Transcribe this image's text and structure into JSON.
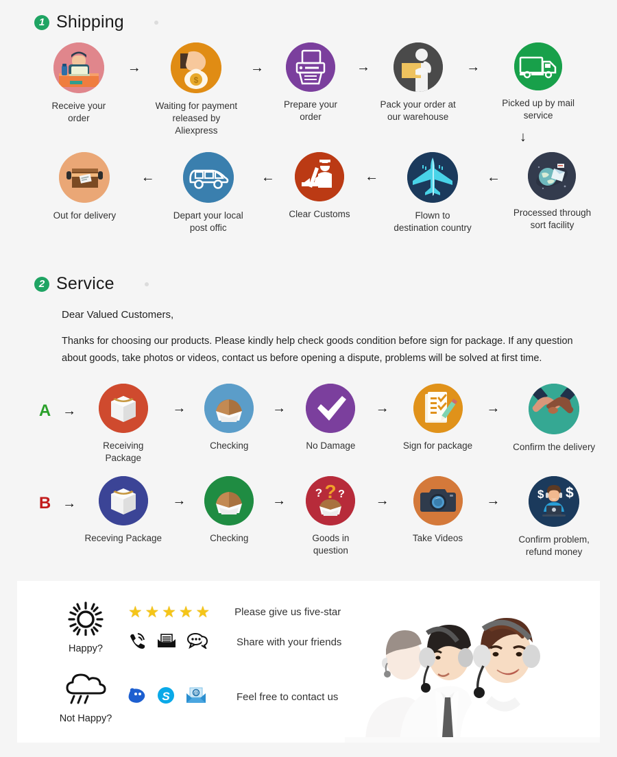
{
  "page": {
    "background": "#f5f5f5",
    "card_background": "#ffffff",
    "badge_color": "#1fa463",
    "text_color": "#333333"
  },
  "sections": [
    {
      "number": "1",
      "title": "Shipping"
    },
    {
      "number": "2",
      "title": "Service"
    }
  ],
  "shipping": {
    "row1": [
      {
        "label": "Receive your order",
        "icon": "person-at-desk-icon",
        "color": "#e0868c"
      },
      {
        "label": "Waiting for payment\nreleased by Aliexpress",
        "icon": "hand-money-bag-icon",
        "color": "#e08c14"
      },
      {
        "label": "Prepare your order",
        "icon": "printer-icon",
        "color": "#7b3f9d"
      },
      {
        "label": "Pack your order at\nour warehouse",
        "icon": "worker-package-icon",
        "color": "#4a4a4a"
      },
      {
        "label": "Picked up by mail service",
        "icon": "delivery-truck-icon",
        "color": "#18a04a"
      }
    ],
    "row2": [
      {
        "label": "Out for delivery",
        "icon": "parcel-box-icon",
        "color": "#eaa776"
      },
      {
        "label": "Depart your local\npost offic",
        "icon": "delivery-van-icon",
        "color": "#3a7fae"
      },
      {
        "label": "Clear  Customs",
        "icon": "customs-officer-icon",
        "color": "#bb3a14"
      },
      {
        "label": "Flown to\ndestination country",
        "icon": "airplane-icon",
        "color": "#1b3a5c"
      },
      {
        "label": "Processed through\nsort facility",
        "icon": "globe-mail-icon",
        "color": "#333b4d"
      }
    ],
    "arrow_right": "→",
    "arrow_left": "←",
    "arrow_down": "↓"
  },
  "service": {
    "greeting": "Dear Valued Customers,",
    "body": "Thanks for choosing our products. Please kindly help check goods condition before sign for package. If any question about goods, take photos or videos, contact us before opening a dispute, problems will be solved at first time.",
    "row_a": {
      "letter": "A",
      "letter_color": "#2aa02a",
      "steps": [
        {
          "label": "Receiving Package",
          "icon": "white-box-icon",
          "color": "#cf4a2e"
        },
        {
          "label": "Checking",
          "icon": "open-carton-icon",
          "color": "#5b9dc9"
        },
        {
          "label": "No Damage",
          "icon": "check-mark-icon",
          "color": "#7b3f9d"
        },
        {
          "label": "Sign for package",
          "icon": "signed-document-icon",
          "color": "#e0921a"
        },
        {
          "label": "Confirm the delivery",
          "icon": "handshake-icon",
          "color": "#35a893"
        }
      ]
    },
    "row_b": {
      "letter": "B",
      "letter_color": "#c21c1c",
      "steps": [
        {
          "label": "Receving Package",
          "icon": "white-box-icon",
          "color": "#3b4496"
        },
        {
          "label": "Checking",
          "icon": "open-carton-icon",
          "color": "#1f8c42"
        },
        {
          "label": "Goods in question",
          "icon": "question-box-icon",
          "color": "#b72b3a"
        },
        {
          "label": "Take Videos",
          "icon": "camera-icon",
          "color": "#d4793a"
        },
        {
          "label": "Confirm problem,\nrefund money",
          "icon": "support-agent-money-icon",
          "color": "#1b3a5c"
        }
      ]
    }
  },
  "feedback": {
    "happy": {
      "mood_icon": "sun-icon",
      "mood_label": "Happy?",
      "stars": {
        "icon": "star-icon",
        "count": 5,
        "color": "#f5c518"
      },
      "stars_text": "Please give us five-star",
      "share_icons": [
        "phone-ring-icon",
        "envelope-icon",
        "chat-bubble-icon"
      ],
      "share_text": "Share with your friends"
    },
    "not_happy": {
      "mood_icon": "rain-cloud-icon",
      "mood_label": "Not Happy?",
      "contact_icons": [
        "aliwangwang-icon",
        "skype-icon",
        "email-icon"
      ],
      "contact_text": "Feel free to contact us"
    },
    "photo_alt": "customer-service-team-photo"
  }
}
